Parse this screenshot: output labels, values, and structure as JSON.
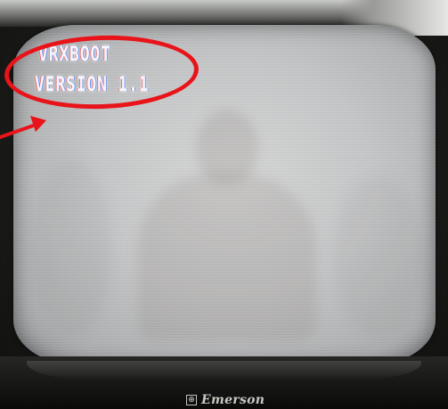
{
  "screen": {
    "line1": "VRXBOOT",
    "line2": "VERSION 1.1"
  },
  "annotation": {
    "color": "#e8141a",
    "shape": "ellipse",
    "pointer": "arrow"
  },
  "tv": {
    "brand": "Emerson",
    "brand_logo_icon": "emerson-logo-icon"
  }
}
